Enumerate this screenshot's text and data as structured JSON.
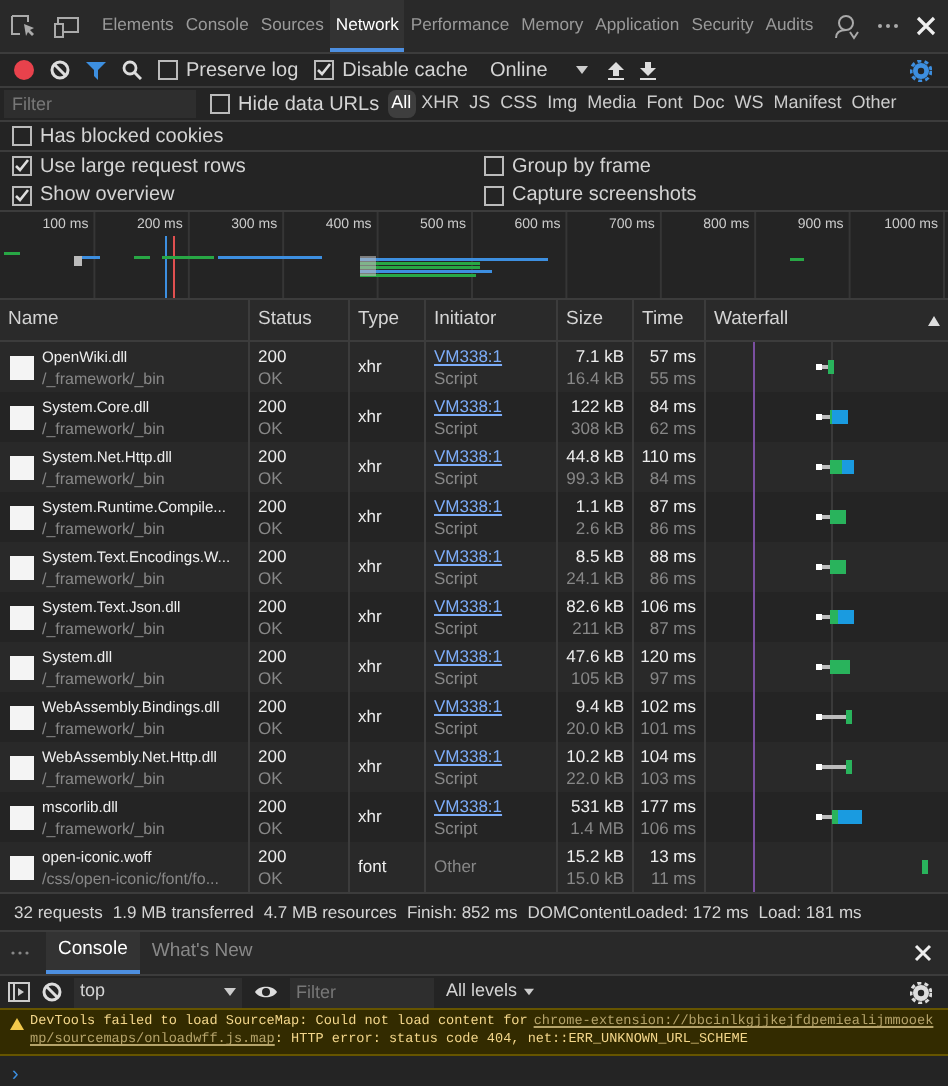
{
  "tabs": [
    {
      "label": "Elements",
      "selected": false
    },
    {
      "label": "Console",
      "selected": false
    },
    {
      "label": "Sources",
      "selected": false
    },
    {
      "label": "Network",
      "selected": true
    },
    {
      "label": "Performance",
      "selected": false
    },
    {
      "label": "Memory",
      "selected": false
    },
    {
      "label": "Application",
      "selected": false
    },
    {
      "label": "Security",
      "selected": false
    },
    {
      "label": "Audits",
      "selected": false
    }
  ],
  "toolbar": {
    "recording": true,
    "preserve_log": {
      "label": "Preserve log",
      "checked": false
    },
    "disable_cache": {
      "label": "Disable cache",
      "checked": true
    },
    "throttling": "Online"
  },
  "filter": {
    "placeholder": "Filter",
    "hide_data_urls": {
      "label": "Hide data URLs",
      "checked": false
    },
    "types": [
      {
        "label": "All",
        "selected": true
      },
      {
        "label": "XHR",
        "selected": false
      },
      {
        "label": "JS",
        "selected": false
      },
      {
        "label": "CSS",
        "selected": false
      },
      {
        "label": "Img",
        "selected": false
      },
      {
        "label": "Media",
        "selected": false
      },
      {
        "label": "Font",
        "selected": false
      },
      {
        "label": "Doc",
        "selected": false
      },
      {
        "label": "WS",
        "selected": false
      },
      {
        "label": "Manifest",
        "selected": false
      },
      {
        "label": "Other",
        "selected": false
      }
    ]
  },
  "blocked_cookies": {
    "label": "Has blocked cookies",
    "checked": false
  },
  "settings_left": [
    {
      "label": "Use large request rows",
      "checked": true
    },
    {
      "label": "Show overview",
      "checked": true
    }
  ],
  "settings_right": [
    {
      "label": "Group by frame",
      "checked": false
    },
    {
      "label": "Capture screenshots",
      "checked": false
    }
  ],
  "overview": {
    "ticks": [
      "100 ms",
      "200 ms",
      "300 ms",
      "400 ms",
      "500 ms",
      "600 ms",
      "700 ms",
      "800 ms",
      "900 ms",
      "1000 ms"
    ]
  },
  "table": {
    "columns": [
      "Name",
      "Status",
      "Type",
      "Initiator",
      "Size",
      "Time",
      "Waterfall"
    ],
    "rows": [
      {
        "name": "OpenWiki.dll",
        "path": "/_framework/_bin",
        "status": "200",
        "status_text": "OK",
        "type": "xhr",
        "initiator": "VM338:1",
        "initiator_type": "Script",
        "size": "7.1 kB",
        "resource_size": "16.4 kB",
        "time": "57 ms",
        "latency": "55 ms"
      },
      {
        "name": "System.Core.dll",
        "path": "/_framework/_bin",
        "status": "200",
        "status_text": "OK",
        "type": "xhr",
        "initiator": "VM338:1",
        "initiator_type": "Script",
        "size": "122 kB",
        "resource_size": "308 kB",
        "time": "84 ms",
        "latency": "62 ms"
      },
      {
        "name": "System.Net.Http.dll",
        "path": "/_framework/_bin",
        "status": "200",
        "status_text": "OK",
        "type": "xhr",
        "initiator": "VM338:1",
        "initiator_type": "Script",
        "size": "44.8 kB",
        "resource_size": "99.3 kB",
        "time": "110 ms",
        "latency": "84 ms"
      },
      {
        "name": "System.Runtime.Compile...",
        "path": "/_framework/_bin",
        "status": "200",
        "status_text": "OK",
        "type": "xhr",
        "initiator": "VM338:1",
        "initiator_type": "Script",
        "size": "1.1 kB",
        "resource_size": "2.6 kB",
        "time": "87 ms",
        "latency": "86 ms"
      },
      {
        "name": "System.Text.Encodings.W...",
        "path": "/_framework/_bin",
        "status": "200",
        "status_text": "OK",
        "type": "xhr",
        "initiator": "VM338:1",
        "initiator_type": "Script",
        "size": "8.5 kB",
        "resource_size": "24.1 kB",
        "time": "88 ms",
        "latency": "86 ms"
      },
      {
        "name": "System.Text.Json.dll",
        "path": "/_framework/_bin",
        "status": "200",
        "status_text": "OK",
        "type": "xhr",
        "initiator": "VM338:1",
        "initiator_type": "Script",
        "size": "82.6 kB",
        "resource_size": "211 kB",
        "time": "106 ms",
        "latency": "87 ms"
      },
      {
        "name": "System.dll",
        "path": "/_framework/_bin",
        "status": "200",
        "status_text": "OK",
        "type": "xhr",
        "initiator": "VM338:1",
        "initiator_type": "Script",
        "size": "47.6 kB",
        "resource_size": "105 kB",
        "time": "120 ms",
        "latency": "97 ms"
      },
      {
        "name": "WebAssembly.Bindings.dll",
        "path": "/_framework/_bin",
        "status": "200",
        "status_text": "OK",
        "type": "xhr",
        "initiator": "VM338:1",
        "initiator_type": "Script",
        "size": "9.4 kB",
        "resource_size": "20.0 kB",
        "time": "102 ms",
        "latency": "101 ms"
      },
      {
        "name": "WebAssembly.Net.Http.dll",
        "path": "/_framework/_bin",
        "status": "200",
        "status_text": "OK",
        "type": "xhr",
        "initiator": "VM338:1",
        "initiator_type": "Script",
        "size": "10.2 kB",
        "resource_size": "22.0 kB",
        "time": "104 ms",
        "latency": "103 ms"
      },
      {
        "name": "mscorlib.dll",
        "path": "/_framework/_bin",
        "status": "200",
        "status_text": "OK",
        "type": "xhr",
        "initiator": "VM338:1",
        "initiator_type": "Script",
        "size": "531 kB",
        "resource_size": "1.4 MB",
        "time": "177 ms",
        "latency": "106 ms"
      },
      {
        "name": "open-iconic.woff",
        "path": "/css/open-iconic/font/fo...",
        "status": "200",
        "status_text": "OK",
        "type": "font",
        "initiator": "Other",
        "size": "15.2 kB",
        "resource_size": "15.0 kB",
        "time": "13 ms",
        "latency": "11 ms"
      }
    ]
  },
  "status_bar": [
    "32 requests",
    "1.9 MB transferred",
    "4.7 MB resources",
    "Finish: 852 ms",
    "DOMContentLoaded: 172 ms",
    "Load: 181 ms"
  ],
  "drawer": {
    "tabs": [
      {
        "label": "Console",
        "selected": true
      },
      {
        "label": "What's New",
        "selected": false
      }
    ],
    "context": "top",
    "filter_placeholder": "Filter",
    "levels": "All levels",
    "messages": [
      {
        "kind": "warning",
        "text": "DevTools failed to load SourceMap: Could not load content for ",
        "link_lines": [
          "chrome-extension://bbcinlkgjjkejfdpemiealijmmooek",
          "mp/sourcemaps/onloadwff.js.map"
        ],
        "after": ": HTTP error: status code 404, net::ERR_UNKNOWN_URL_SCHEME"
      }
    ],
    "prompt": "›"
  }
}
